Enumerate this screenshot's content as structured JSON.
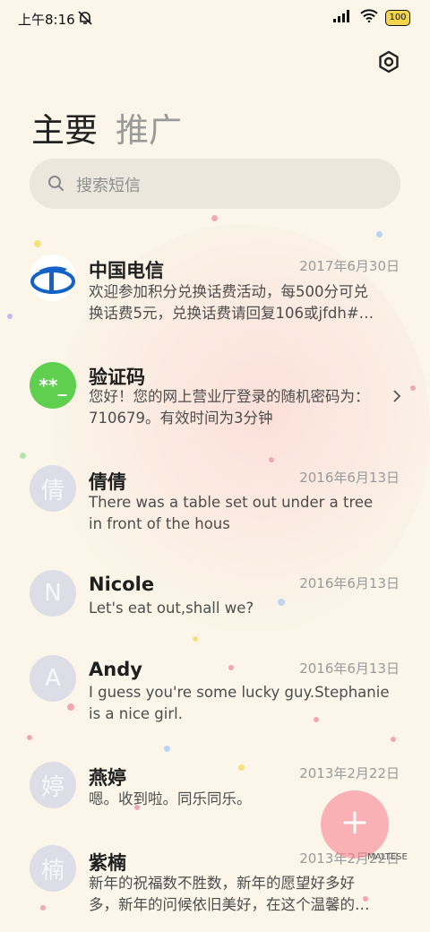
{
  "status_bar": {
    "time": "上午8:16",
    "battery": "100"
  },
  "tabs": {
    "main": "主要",
    "promo": "推广"
  },
  "search": {
    "placeholder": "搜索短信"
  },
  "conversations": [
    {
      "name": "中国电信",
      "date": "2017年6月30日",
      "line1": "欢迎参加积分兑换话费活动，每500分可兑",
      "line2": "换话费5元，兑换话费请回复106或jfdh#…",
      "avatar": "china-telecom-logo"
    },
    {
      "name": "验证码",
      "date": "",
      "line1": "您好！您的网上营业厅登录的随机密码为：",
      "line2": "710679。有效时间为3分钟",
      "avatar_text": "**_"
    },
    {
      "name": "倩倩",
      "date": "2016年6月13日",
      "line1": "There was a table set out under a tree",
      "line2": "in front of the hous",
      "avatar_text": "倩"
    },
    {
      "name": "Nicole",
      "date": "2016年6月13日",
      "line1": "Let's eat out,shall we?",
      "line2": "",
      "avatar_text": "N"
    },
    {
      "name": "Andy",
      "date": "2016年6月13日",
      "line1": "I guess you're some lucky guy.Stephanie",
      "line2": "is a nice girl.",
      "avatar_text": "A"
    },
    {
      "name": "燕婷",
      "date": "2013年2月22日",
      "line1": "嗯。收到啦。同乐同乐。",
      "line2": "",
      "avatar_text": "婷"
    },
    {
      "name": "紫楠",
      "date": "2013年2月22日",
      "line1": "新年的祝福数不胜数，新年的愿望好多好",
      "line2": "多，新年的问候依旧美好，在这个温馨的…",
      "avatar_text": "楠"
    }
  ],
  "fab": {
    "label": "+"
  },
  "watermark": "MALTESE",
  "colors": {
    "background": "#fbf6e9",
    "verify_avatar": "#5fcf4f",
    "telecom_blue": "#1462c8",
    "fab": "#f8788c"
  }
}
